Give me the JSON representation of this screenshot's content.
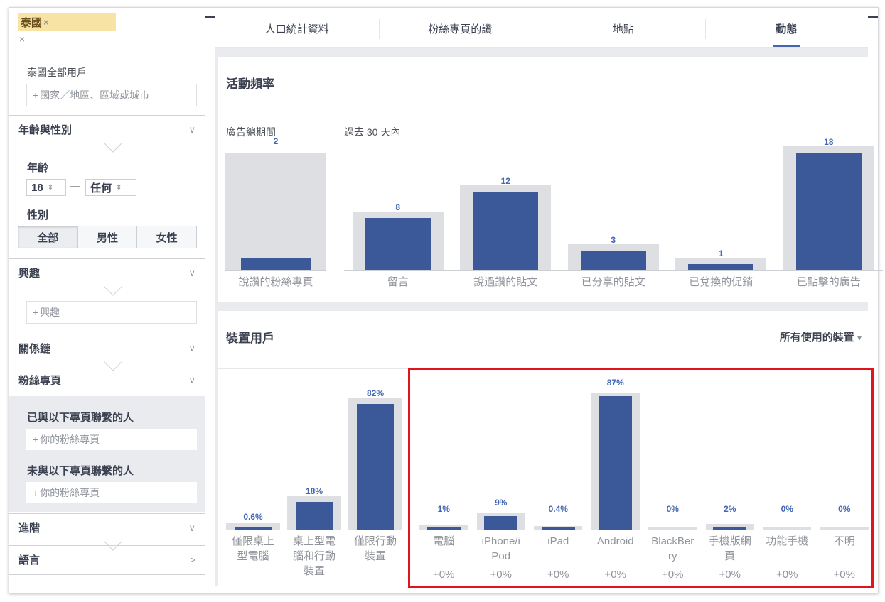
{
  "sidebar": {
    "location_tag": "泰國",
    "location_tag_remove": "×",
    "location_remove": "×",
    "location_desc": "泰國全部用戶",
    "location_placeholder": "國家／地區、區域或城市",
    "sections": {
      "age_gender": "年齡與性別",
      "interests": "興趣",
      "relationship": "關係鏈",
      "fan_pages": "粉絲專頁",
      "advanced": "進階",
      "language": "語言"
    },
    "age_label": "年齡",
    "age_min": "18",
    "age_sep": "—",
    "age_max": "任何",
    "gender_label": "性別",
    "gender_options": [
      "全部",
      "男性",
      "女性"
    ],
    "interest_placeholder": "興趣",
    "connected_label": "已與以下專頁聯繫的人",
    "connected_placeholder": "你的粉絲專頁",
    "not_connected_label": "未與以下專頁聯繫的人",
    "not_connected_placeholder": "你的粉絲專頁",
    "plus": "+",
    "chevron_down": "∨",
    "chevron_right": ">"
  },
  "tabs": [
    "人口統計資料",
    "粉絲專頁的讚",
    "地點",
    "動態"
  ],
  "active_tab": 3,
  "activity": {
    "title": "活動頻率",
    "left_header": "廣告總期間",
    "right_header": "過去 30 天內"
  },
  "devices": {
    "title": "裝置用戶",
    "dropdown": "所有使用的裝置",
    "dropdown_arrow": "▾"
  },
  "colors": {
    "bar": "#3b5998",
    "bar_bg": "#dddfe2",
    "accent": "#4267b2",
    "highlight_box": "#e3131b"
  },
  "chart_data": [
    {
      "type": "bar",
      "title": "活動頻率",
      "group": "廣告總期間",
      "categories": [
        "說讚的粉絲專頁"
      ],
      "values": [
        2
      ]
    },
    {
      "type": "bar",
      "title": "活動頻率",
      "group": "過去 30 天內",
      "categories": [
        "留言",
        "說過讚的貼文",
        "已分享的貼文",
        "已兌換的促銷",
        "已點擊的廣告"
      ],
      "values": [
        8,
        12,
        3,
        1,
        18
      ]
    },
    {
      "type": "bar",
      "title": "裝置用戶",
      "categories": [
        "僅限桌上型電腦",
        "桌上型電腦和行動裝置",
        "僅限行動裝置"
      ],
      "category_lines": [
        [
          "僅限桌上",
          "型電腦"
        ],
        [
          "桌上型電",
          "腦和行動",
          "裝置"
        ],
        [
          "僅限行動",
          "裝置"
        ]
      ],
      "values": [
        0.6,
        18,
        82
      ],
      "value_labels": [
        "0.6%",
        "18%",
        "82%"
      ]
    },
    {
      "type": "bar",
      "title": "裝置用戶",
      "categories": [
        "電腦",
        "iPhone/iPod",
        "iPad",
        "Android",
        "BlackBerry",
        "手機版網頁",
        "功能手機",
        "不明"
      ],
      "category_lines": [
        [
          "電腦"
        ],
        [
          "iPhone/i",
          "Pod"
        ],
        [
          "iPad"
        ],
        [
          "Android"
        ],
        [
          "BlackBer",
          "ry"
        ],
        [
          "手機版網",
          "頁"
        ],
        [
          "功能手機"
        ],
        [
          "不明"
        ]
      ],
      "values": [
        1,
        9,
        0.4,
        87,
        0,
        2,
        0,
        0
      ],
      "value_labels": [
        "1%",
        "9%",
        "0.4%",
        "87%",
        "0%",
        "2%",
        "0%",
        "0%"
      ],
      "changes": [
        "+0%",
        "+0%",
        "+0%",
        "+0%",
        "+0%",
        "+0%",
        "+0%",
        "+0%"
      ]
    }
  ]
}
